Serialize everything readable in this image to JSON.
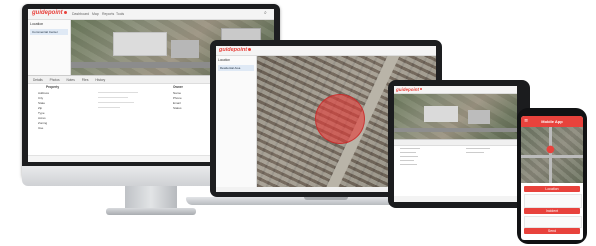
{
  "brand": {
    "logo_text": "guidepoint",
    "accent_color": "#e8423c",
    "map_highlight_color": "rgba(229, 57, 53, 0.55)"
  },
  "desktop": {
    "nav_tabs": [
      "Dashboard",
      "Map",
      "Reports",
      "Tools"
    ],
    "sidebar_title": "Location",
    "sidebar_item": "Commercial Center",
    "detail_tabs": [
      "Details",
      "Photos",
      "Notes",
      "Files",
      "History"
    ],
    "left_section": "Property",
    "right_section": "Owner",
    "left_fields": [
      "Address",
      "City",
      "State",
      "Zip",
      "Type",
      "Acres",
      "Zoning",
      "Use"
    ],
    "right_fields": [
      "Name",
      "Phone",
      "Email",
      "Status"
    ]
  },
  "laptop": {
    "sidebar_title": "Location",
    "sidebar_item": "Residential Area"
  },
  "phone": {
    "app_title": "Mobile App",
    "card_1": "Location",
    "card_2": "Incident",
    "action_button": "Send"
  },
  "icons": {
    "desktop_search": "search-icon",
    "phone_pin": "map-pin-icon",
    "phone_menu": "menu-icon",
    "tablet_home_button": "home-button"
  }
}
